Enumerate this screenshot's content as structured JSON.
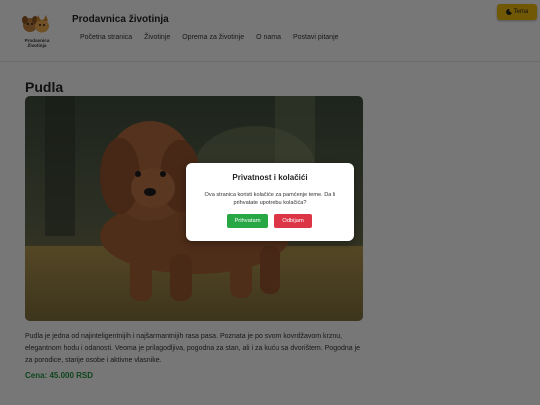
{
  "header": {
    "logo_text": "Prodavnica Životinja",
    "site_title": "Prodavnica životinja",
    "nav": [
      "Početna stranica",
      "Životinje",
      "Oprema za životinje",
      "O nama",
      "Postavi pitanje"
    ],
    "theme_button": "Tema",
    "theme_icon": "moon-icon"
  },
  "main": {
    "page_title": "Pudla",
    "description": "Pudla je jedna od najinteligentnijih i najšarmantnijih rasa pasa. Poznata je po svom kovrdžavom krznu, elegantnom hodu i odanosti. Veoma je prilagodljiva, pogodna za stan, ali i za kuću sa dvorištem. Pogodna je za porodice, starije osobe i aktivne vlasnike.",
    "price": "Cena: 45.000 RSD"
  },
  "cookie_modal": {
    "title": "Privatnost i kolačići",
    "text": "Ova stranica koristi kolačiće za pamćenje teme. Da li prihvatate upotrebu kolačića?",
    "accept_label": "Prihvatam",
    "reject_label": "Odbijam"
  },
  "colors": {
    "accent_green": "#28a745",
    "accent_red": "#dc3545",
    "theme_button": "#e2b10a",
    "price": "#1f8c3a"
  }
}
